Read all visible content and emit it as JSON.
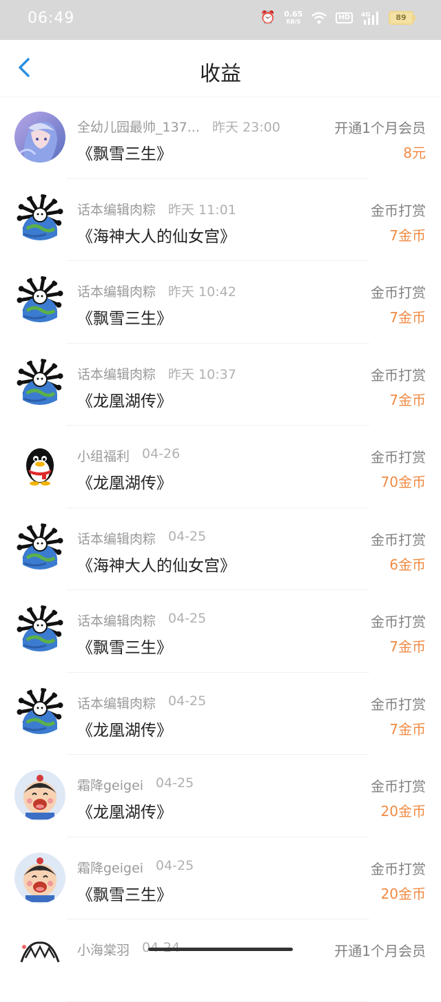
{
  "status_bar": {
    "time": "06:49",
    "net_speed": "0.65",
    "net_unit": "KB/S",
    "network": "4G",
    "hd": "HD",
    "battery": "89"
  },
  "header": {
    "title": "收益"
  },
  "rows": [
    {
      "name": "全幼儿园最帅_137...",
      "time": "昨天 23:00",
      "type": "开通1个月会员",
      "book": "《飘雪三生》",
      "amount": "8元",
      "avatar": "anime-girl"
    },
    {
      "name": "话本编辑肉粽",
      "time": "昨天 11:01",
      "type": "金币打赏",
      "book": "《海神大人的仙女宫》",
      "amount": "7金币",
      "avatar": "bone-globe"
    },
    {
      "name": "话本编辑肉粽",
      "time": "昨天 10:42",
      "type": "金币打赏",
      "book": "《飘雪三生》",
      "amount": "7金币",
      "avatar": "bone-globe"
    },
    {
      "name": "话本编辑肉粽",
      "time": "昨天 10:37",
      "type": "金币打赏",
      "book": "《龙凰湖传》",
      "amount": "7金币",
      "avatar": "bone-globe"
    },
    {
      "name": "小组福利",
      "time": "04-26",
      "type": "金币打赏",
      "book": "《龙凰湖传》",
      "amount": "70金币",
      "avatar": "penguin"
    },
    {
      "name": "话本编辑肉粽",
      "time": "04-25",
      "type": "金币打赏",
      "book": "《海神大人的仙女宫》",
      "amount": "6金币",
      "avatar": "bone-globe"
    },
    {
      "name": "话本编辑肉粽",
      "time": "04-25",
      "type": "金币打赏",
      "book": "《飘雪三生》",
      "amount": "7金币",
      "avatar": "bone-globe"
    },
    {
      "name": "话本编辑肉粽",
      "time": "04-25",
      "type": "金币打赏",
      "book": "《龙凰湖传》",
      "amount": "7金币",
      "avatar": "bone-globe"
    },
    {
      "name": "霜降geigei",
      "time": "04-25",
      "type": "金币打赏",
      "book": "《龙凰湖传》",
      "amount": "20金币",
      "avatar": "cartoon-boy"
    },
    {
      "name": "霜降geigei",
      "time": "04-25",
      "type": "金币打赏",
      "book": "《飘雪三生》",
      "amount": "20金币",
      "avatar": "cartoon-boy"
    },
    {
      "name": "小海棠羽",
      "time": "04-24",
      "type": "开通1个月会员",
      "book": "",
      "amount": "",
      "avatar": "anime-sketch"
    }
  ],
  "colors": {
    "accent": "#2a90e0",
    "amount": "#f08a43",
    "status_bar": "#d8d8d8"
  }
}
